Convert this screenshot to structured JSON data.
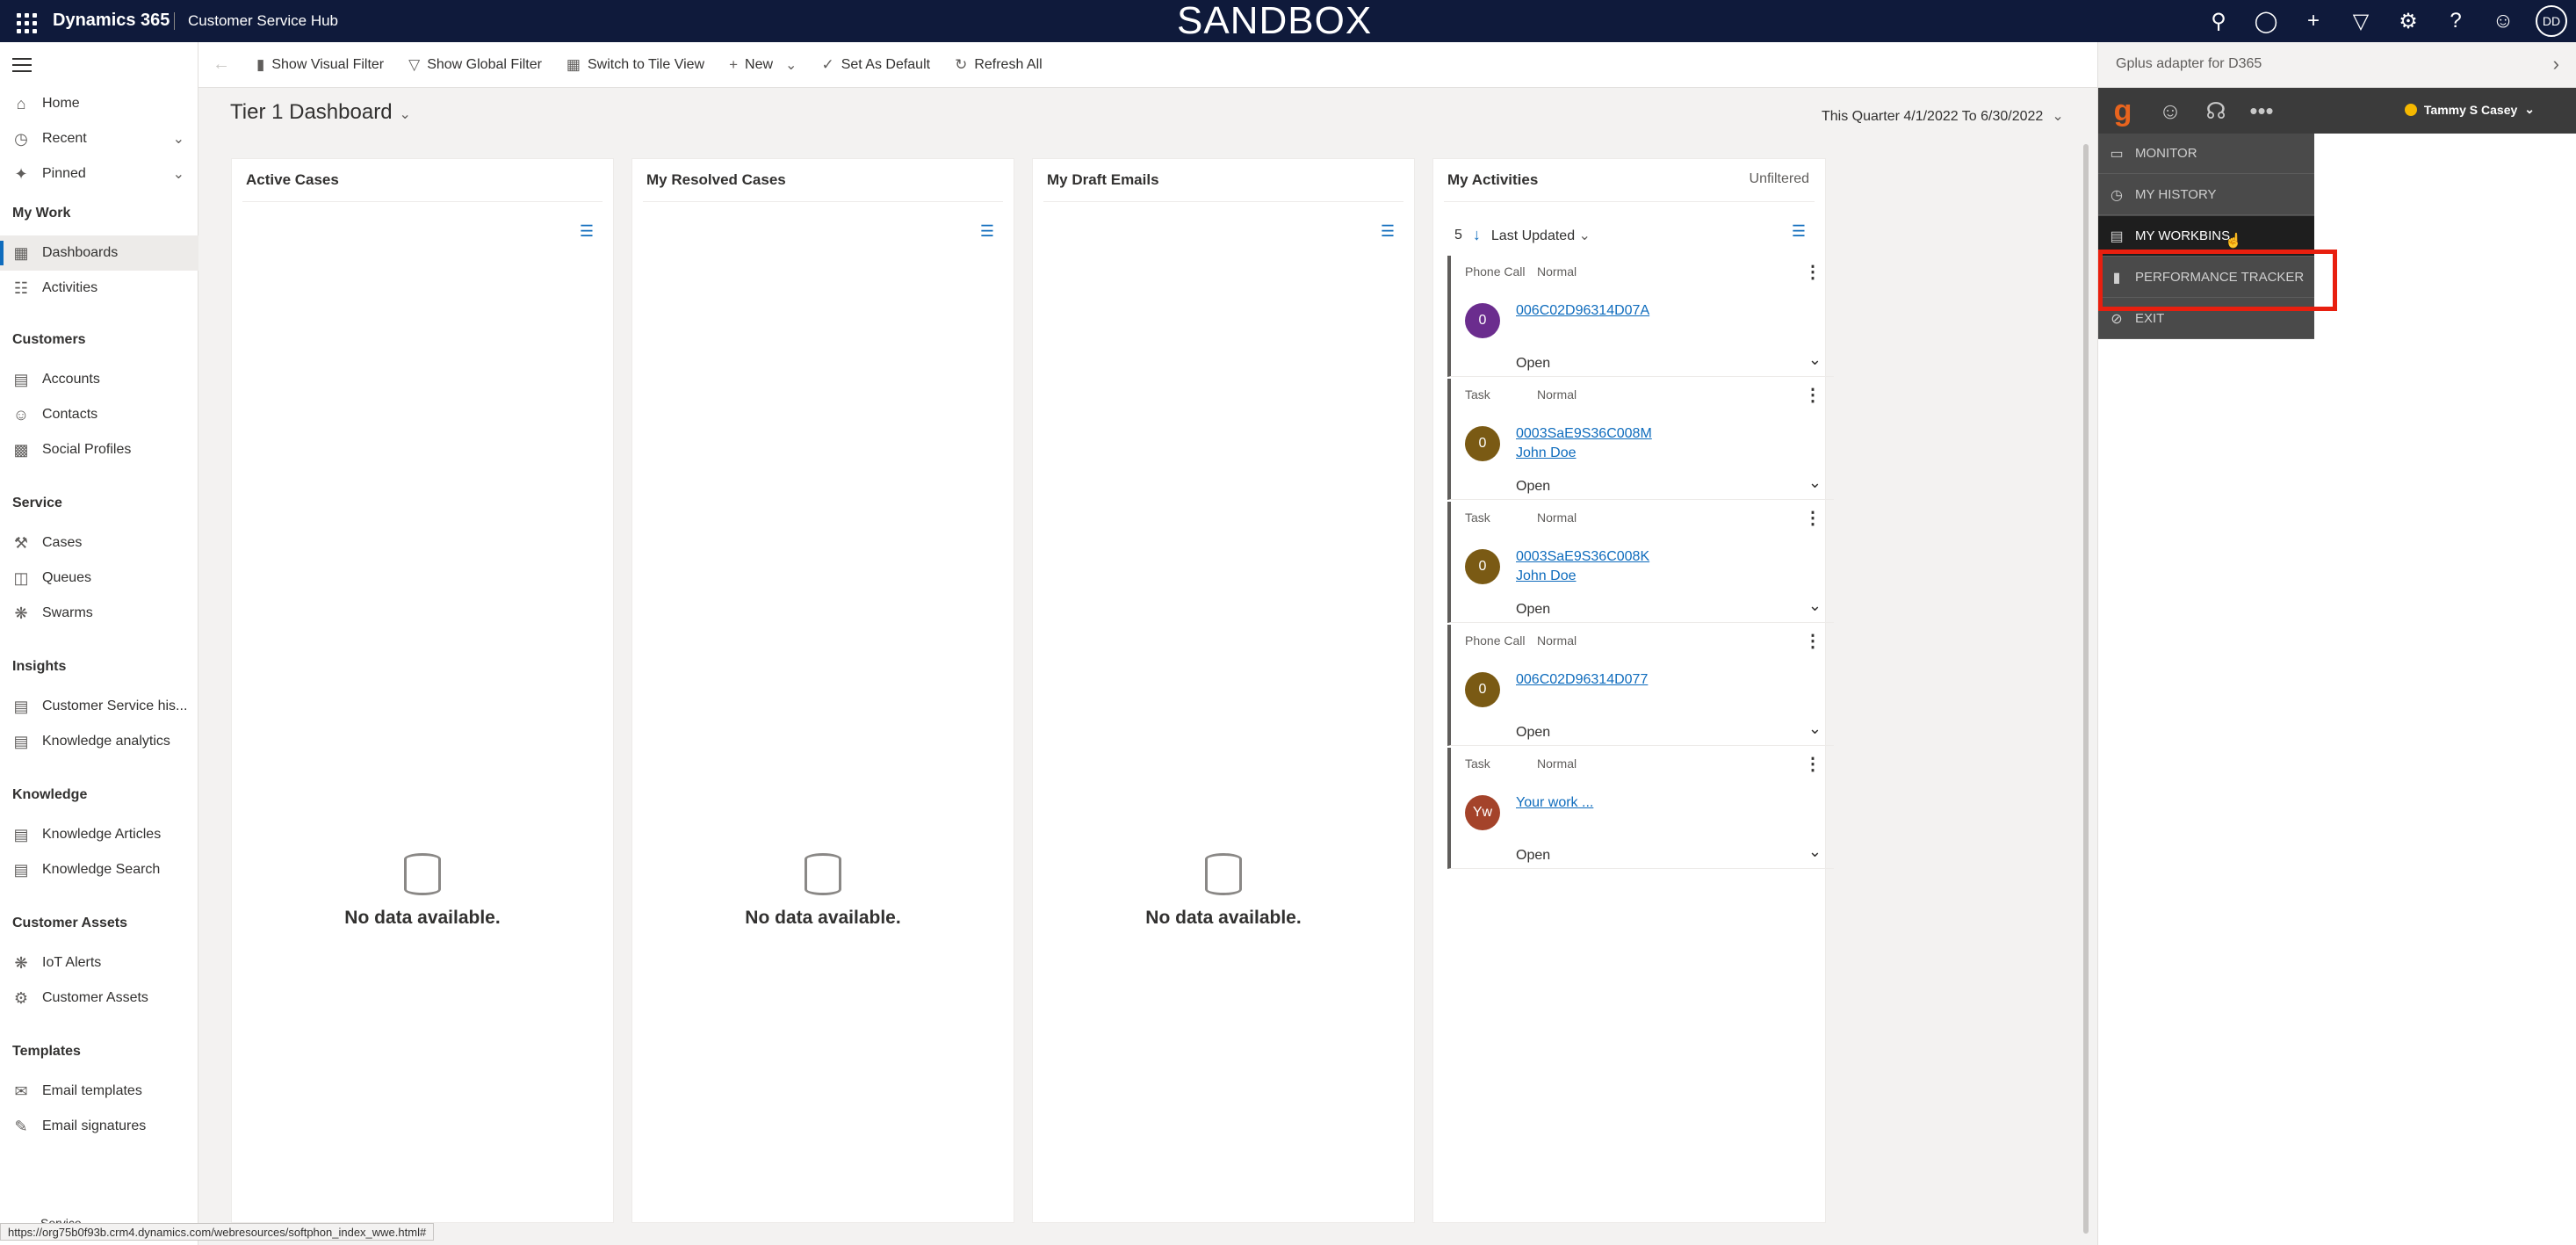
{
  "topbar": {
    "app_name": "Dynamics 365",
    "hub_name": "Customer Service Hub",
    "banner": "SANDBOX",
    "user_initials": "DD"
  },
  "leftnav": {
    "home": "Home",
    "recent": "Recent",
    "pinned": "Pinned",
    "groups": {
      "my_work": "My Work",
      "customers": "Customers",
      "service": "Service",
      "insights": "Insights",
      "knowledge": "Knowledge",
      "customer_assets": "Customer Assets",
      "templates": "Templates"
    },
    "items": {
      "dashboards": "Dashboards",
      "activities": "Activities",
      "accounts": "Accounts",
      "contacts": "Contacts",
      "social_profiles": "Social Profiles",
      "cases": "Cases",
      "queues": "Queues",
      "swarms": "Swarms",
      "cs_historical": "Customer Service his...",
      "knowledge_analytics": "Knowledge analytics",
      "knowledge_articles": "Knowledge Articles",
      "knowledge_search": "Knowledge Search",
      "iot_alerts": "IoT Alerts",
      "customer_assets": "Customer Assets",
      "email_templates": "Email templates",
      "email_signatures": "Email signatures"
    },
    "area_switcher": "Service"
  },
  "cmdbar": {
    "show_visual_filter": "Show Visual Filter",
    "show_global_filter": "Show Global Filter",
    "switch_tile_view": "Switch to Tile View",
    "new": "New",
    "set_default": "Set As Default",
    "refresh_all": "Refresh All"
  },
  "dashboard": {
    "title": "Tier 1 Dashboard",
    "date_range": "This Quarter 4/1/2022 To 6/30/2022",
    "no_data": "No data available.",
    "panels": {
      "active_cases": "Active Cases",
      "resolved_cases": "My Resolved Cases",
      "draft_emails": "My Draft Emails",
      "activities": "My Activities"
    },
    "activities": {
      "filter_state": "Unfiltered",
      "count": "5",
      "sort_label": "Last Updated",
      "items": [
        {
          "type": "Phone Call",
          "priority": "Normal",
          "initial": "0",
          "color": "#6b2d8e",
          "subject": "006C02D96314D07A",
          "regarding": "",
          "status": "Open"
        },
        {
          "type": "Task",
          "priority": "Normal",
          "initial": "0",
          "color": "#7a5a14",
          "subject": "0003SaE9S36C008M",
          "regarding": "John Doe",
          "status": "Open"
        },
        {
          "type": "Task",
          "priority": "Normal",
          "initial": "0",
          "color": "#7a5a14",
          "subject": "0003SaE9S36C008K",
          "regarding": "John Doe",
          "status": "Open"
        },
        {
          "type": "Phone Call",
          "priority": "Normal",
          "initial": "0",
          "color": "#7a5a14",
          "subject": "006C02D96314D077",
          "regarding": "",
          "status": "Open"
        },
        {
          "type": "Task",
          "priority": "Normal",
          "initial": "Yw",
          "color": "#a4432a",
          "subject": "Your work ...",
          "regarding": "",
          "status": "Open"
        }
      ]
    }
  },
  "sidepane": {
    "title": "Gplus adapter for D365",
    "agent_name": "Tammy S Casey",
    "menu": [
      "MONITOR",
      "MY HISTORY",
      "MY WORKBINS",
      "PERFORMANCE TRACKER",
      "EXIT"
    ],
    "selected": "MY WORKBINS",
    "highlight_color": "#e81f0f",
    "accent_color": "#e8641e"
  },
  "statusbar": {
    "url": "https://org75b0f93b.crm4.dynamics.com/webresources/softphon_index_wwe.html#"
  }
}
